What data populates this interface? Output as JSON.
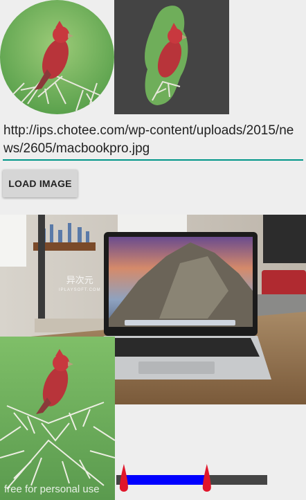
{
  "url_input": {
    "value": "http://ips.chotee.com/wp-content/uploads/2015/news/2605/macbookpro.jpg"
  },
  "load_button": {
    "label": "LOAD IMAGE"
  },
  "photo_watermark": {
    "title": "异次元",
    "subtitle": "IPLAYSOFT.COM"
  },
  "mirror_watermark": {
    "text": "free for personal use"
  },
  "range_slider": {
    "min_fraction": 0.05,
    "max_fraction": 0.6,
    "track_color": "#444444",
    "range_color": "#0000ff",
    "thumb_color": "#e0162b"
  }
}
